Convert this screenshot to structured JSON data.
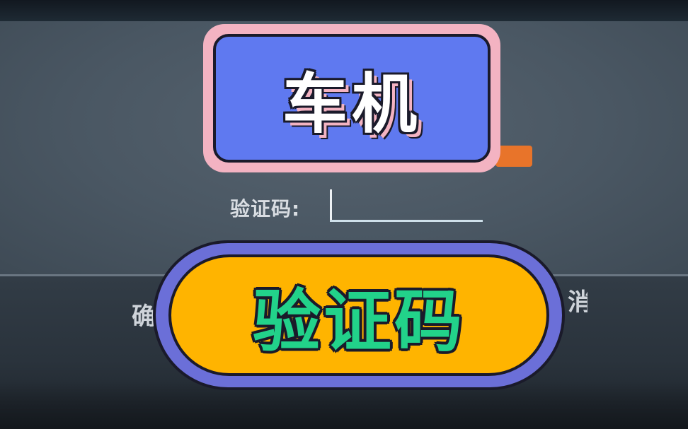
{
  "overlay": {
    "title": "车机",
    "subtitle": "验证码"
  },
  "dialog": {
    "code_label": "验证码:",
    "code_value": "",
    "confirm_label_partial": "确",
    "cancel_label_partial": "消"
  },
  "colors": {
    "title_banner_border": "#f3b3c2",
    "title_banner_fill": "#5f79f0",
    "code_banner_border": "#6b6fd8",
    "code_banner_fill": "#ffb400",
    "code_banner_text": "#22d28a",
    "get_code_button": "#e8742a"
  }
}
